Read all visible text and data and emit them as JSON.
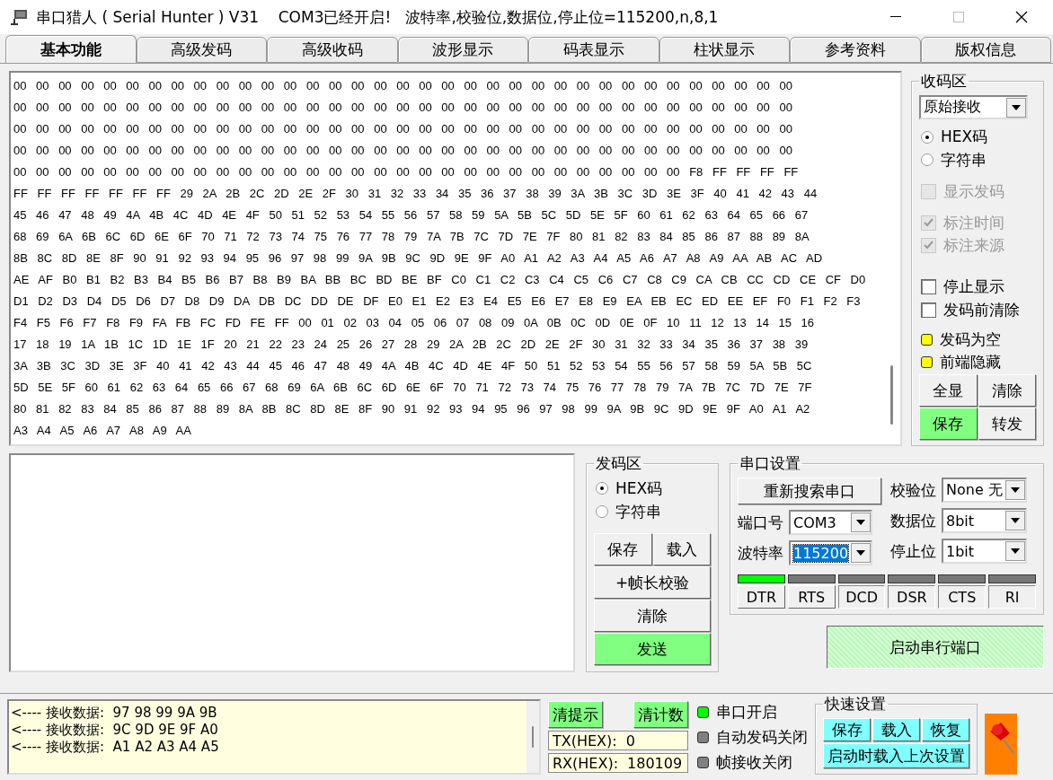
{
  "window": {
    "title": "串口猎人 ( Serial Hunter ) V31    COM3已经开启!   波特率,校验位,数据位,停止位=115200,n,8,1"
  },
  "tabs": [
    {
      "label": "基本功能",
      "selected": true
    },
    {
      "label": "高级发码",
      "selected": false
    },
    {
      "label": "高级收码",
      "selected": false
    },
    {
      "label": "波形显示",
      "selected": false
    },
    {
      "label": "码表显示",
      "selected": false
    },
    {
      "label": "柱状显示",
      "selected": false
    },
    {
      "label": "参考资料",
      "selected": false
    },
    {
      "label": "版权信息",
      "selected": false
    }
  ],
  "receive": {
    "lines": [
      "00 00 00 00 00 00 00 00 00 00 00 00 00 00 00 00 00 00 00 00 00 00 00 00 00 00 00 00 00 00 00 00 00 00 00",
      "00 00 00 00 00 00 00 00 00 00 00 00 00 00 00 00 00 00 00 00 00 00 00 00 00 00 00 00 00 00 00 00 00 00 00",
      "00 00 00 00 00 00 00 00 00 00 00 00 00 00 00 00 00 00 00 00 00 00 00 00 00 00 00 00 00 00 00 00 00 00 00",
      "00 00 00 00 00 00 00 00 00 00 00 00 00 00 00 00 00 00 00 00 00 00 00 00 00 00 00 00 00 00 00 00 00 00 00",
      "00 00 00 00 00 00 00 00 00 00 00 00 00 00 00 00 00 00 00 00 00 00 00 00 00 00 00 00 00 00 F8 FF FF FF FF",
      "FF FF FF FF FF FF FF 29 2A 2B 2C 2D 2E 2F 30 31 32 33 34 35 36 37 38 39 3A 3B 3C 3D 3E 3F 40 41 42 43 44",
      "45 46 47 48 49 4A 4B 4C 4D 4E 4F 50 51 52 53 54 55 56 57 58 59 5A 5B 5C 5D 5E 5F 60 61 62 63 64 65 66 67",
      "68 69 6A 6B 6C 6D 6E 6F 70 71 72 73 74 75 76 77 78 79 7A 7B 7C 7D 7E 7F 80 81 82 83 84 85 86 87 88 89 8A",
      "8B 8C 8D 8E 8F 90 91 92 93 94 95 96 97 98 99 9A 9B 9C 9D 9E 9F A0 A1 A2 A3 A4 A5 A6 A7 A8 A9 AA AB AC AD",
      "AE AF B0 B1 B2 B3 B4 B5 B6 B7 B8 B9 BA BB BC BD BE BF C0 C1 C2 C3 C4 C5 C6 C7 C8 C9 CA CB CC CD CE CF D0",
      "D1 D2 D3 D4 D5 D6 D7 D8 D9 DA DB DC DD DE DF E0 E1 E2 E3 E4 E5 E6 E7 E8 E9 EA EB EC ED EE EF F0 F1 F2 F3",
      "F4 F5 F6 F7 F8 F9 FA FB FC FD FE FF 00 01 02 03 04 05 06 07 08 09 0A 0B 0C 0D 0E 0F 10 11 12 13 14 15 16",
      "17 18 19 1A 1B 1C 1D 1E 1F 20 21 22 23 24 25 26 27 28 29 2A 2B 2C 2D 2E 2F 30 31 32 33 34 35 36 37 38 39",
      "3A 3B 3C 3D 3E 3F 40 41 42 43 44 45 46 47 48 49 4A 4B 4C 4D 4E 4F 50 51 52 53 54 55 56 57 58 59 5A 5B 5C",
      "5D 5E 5F 60 61 62 63 64 65 66 67 68 69 6A 6B 6C 6D 6E 6F 70 71 72 73 74 75 76 77 78 79 7A 7B 7C 7D 7E 7F",
      "80 81 82 83 84 85 86 87 88 89 8A 8B 8C 8D 8E 8F 90 91 92 93 94 95 96 97 98 99 9A 9B 9C 9D 9E 9F A0 A1 A2",
      "A3 A4 A5 A6 A7 A8 A9 AA"
    ]
  },
  "receive_panel": {
    "title": "收码区",
    "mode": "原始接收",
    "radios": [
      {
        "label": "HEX码",
        "selected": true
      },
      {
        "label": "字符串",
        "selected": false
      }
    ],
    "checkboxes": [
      {
        "label": "显示发码",
        "checked": false,
        "disabled": true
      },
      {
        "label": "标注时间",
        "checked": true,
        "disabled": true
      },
      {
        "label": "标注来源",
        "checked": true,
        "disabled": true
      },
      {
        "label": "停止显示",
        "checked": false,
        "disabled": false
      },
      {
        "label": "发码前清除",
        "checked": false,
        "disabled": false
      }
    ],
    "indicators": [
      {
        "label": "发码为空",
        "color": "#ffff00"
      },
      {
        "label": "前端隐藏",
        "color": "#ffff00"
      }
    ],
    "buttons": [
      {
        "label": "全显",
        "highlighted": false
      },
      {
        "label": "清除",
        "highlighted": false
      },
      {
        "label": "保存",
        "highlighted": true
      },
      {
        "label": "转发",
        "highlighted": false
      }
    ]
  },
  "send_panel": {
    "title": "发码区",
    "radios": [
      {
        "label": "HEX码",
        "selected": true
      },
      {
        "label": "字符串",
        "selected": false
      }
    ],
    "buttons": [
      {
        "label": "保存",
        "highlighted": false,
        "wide": false
      },
      {
        "label": "载入",
        "highlighted": false,
        "wide": false
      },
      {
        "label": "+帧长校验",
        "highlighted": false,
        "wide": true
      },
      {
        "label": "清除",
        "highlighted": false,
        "wide": true
      },
      {
        "label": "发送",
        "highlighted": true,
        "wide": true
      }
    ]
  },
  "serial_settings": {
    "title": "串口设置",
    "rescan_button": "重新搜索串口",
    "left_fields": [
      {
        "label": "端口号",
        "value": "COM3",
        "focused": false
      },
      {
        "label": "波特率",
        "value": "115200",
        "focused": true
      }
    ],
    "right_fields": [
      {
        "label": "校验位",
        "value": "None 无",
        "focused": false
      },
      {
        "label": "数据位",
        "value": "8bit",
        "focused": false
      },
      {
        "label": "停止位",
        "value": "1bit",
        "focused": false
      }
    ],
    "signals": [
      {
        "label": "DTR",
        "on": true,
        "kind": "toggle"
      },
      {
        "label": "RTS",
        "on": false,
        "kind": "toggle"
      },
      {
        "label": "DCD",
        "on": false,
        "kind": "status"
      },
      {
        "label": "DSR",
        "on": false,
        "kind": "status"
      },
      {
        "label": "CTS",
        "on": false,
        "kind": "status"
      },
      {
        "label": "RI",
        "on": false,
        "kind": "status"
      }
    ],
    "start_button": "启动串行端口"
  },
  "status_bar": {
    "log": [
      "<---- 接收数据:  97 98 99 9A 9B",
      "<---- 接收数据:  9C 9D 9E 9F A0",
      "<---- 接收数据:  A1 A2 A3 A4 A5"
    ],
    "buttons": [
      "清提示",
      "清计数"
    ],
    "counters": [
      {
        "label": "TX(HEX):",
        "value": "0"
      },
      {
        "label": "RX(HEX):",
        "value": "180109"
      }
    ],
    "lights": [
      {
        "label": "串口开启",
        "on": true
      },
      {
        "label": "自动发码关闭",
        "on": false
      },
      {
        "label": "帧接收关闭",
        "on": false
      }
    ],
    "quick_settings": {
      "title": "快速设置",
      "buttons": [
        "保存",
        "载入",
        "恢复"
      ],
      "wide_button": "启动时载入上次设置"
    }
  }
}
